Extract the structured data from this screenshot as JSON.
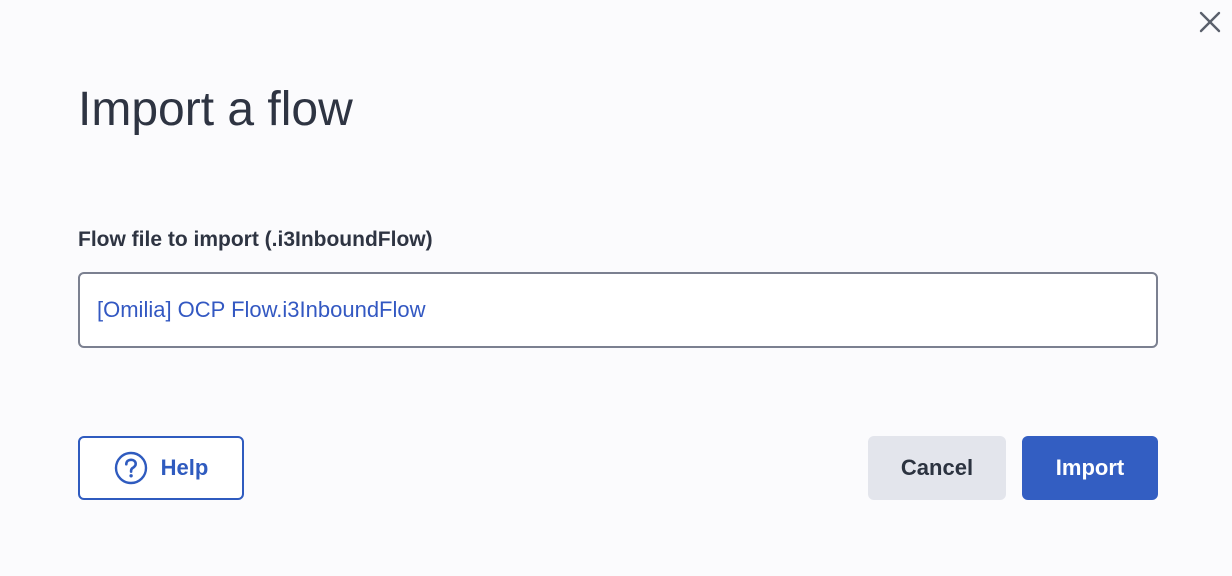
{
  "dialog": {
    "title": "Import a flow",
    "field_label": "Flow file to import (.i3InboundFlow)",
    "file_value": "[Omilia] OCP Flow.i3InboundFlow",
    "buttons": {
      "help_label": "Help",
      "cancel_label": "Cancel",
      "import_label": "Import"
    },
    "icons": {
      "close": "close-icon",
      "help": "question-circle-icon"
    },
    "colors": {
      "accent": "#335ec2",
      "link_text": "#3358c2",
      "cancel_bg": "#e3e5ec",
      "background": "#fbfbfd"
    }
  }
}
